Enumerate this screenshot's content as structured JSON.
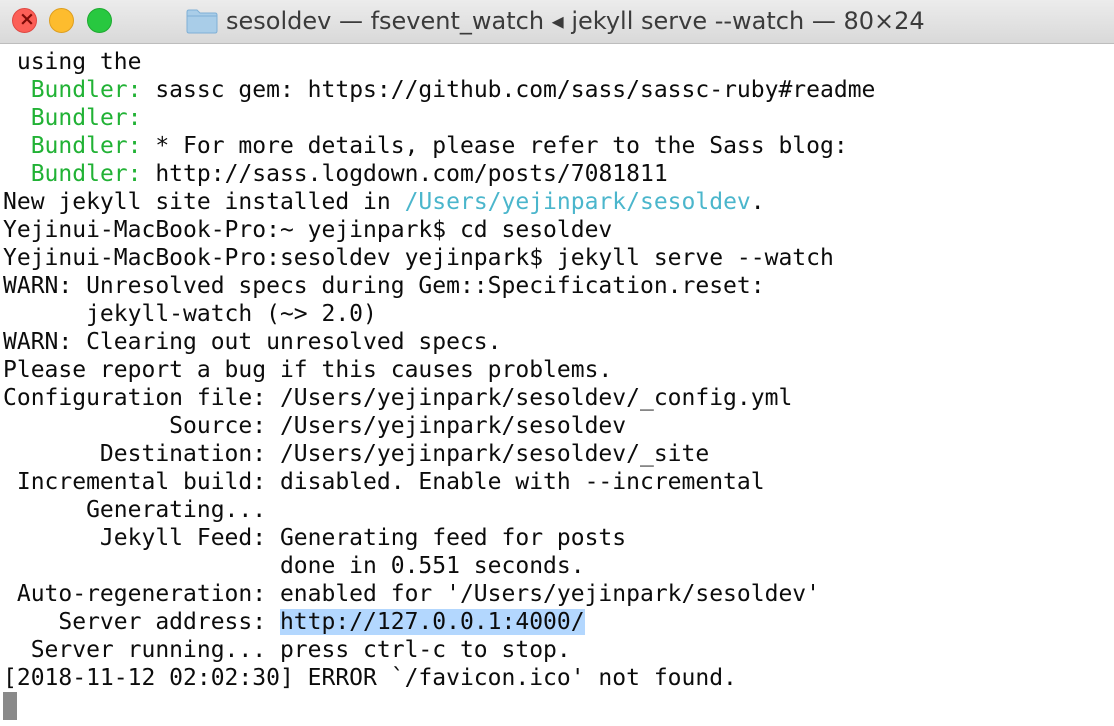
{
  "window": {
    "title": "sesoldev — fsevent_watch ◂ jekyll serve --watch — 80×24"
  },
  "terminal": {
    "lines": [
      {
        "pre": " using the",
        "hl": "",
        "post": ""
      },
      {
        "pre": "  ",
        "hl": "Bundler:",
        "post": " sassc gem: https://github.com/sass/sassc-ruby#readme"
      },
      {
        "pre": "  ",
        "hl": "Bundler:",
        "post": ""
      },
      {
        "pre": "  ",
        "hl": "Bundler:",
        "post": " * For more details, please refer to the Sass blog:"
      },
      {
        "pre": "  ",
        "hl": "Bundler:",
        "post": " http://sass.logdown.com/posts/7081811"
      },
      {
        "pre": "New jekyll site installed in ",
        "hl": "/Users/yejinpark/sesoldev",
        "post": "."
      },
      {
        "pre": "Yejinui-MacBook-Pro:~ yejinpark$ cd sesoldev",
        "hl": "",
        "post": ""
      },
      {
        "pre": "Yejinui-MacBook-Pro:sesoldev yejinpark$ jekyll serve --watch",
        "hl": "",
        "post": ""
      },
      {
        "pre": "WARN: Unresolved specs during Gem::Specification.reset:",
        "hl": "",
        "post": ""
      },
      {
        "pre": "      jekyll-watch (~> 2.0)",
        "hl": "",
        "post": ""
      },
      {
        "pre": "WARN: Clearing out unresolved specs.",
        "hl": "",
        "post": ""
      },
      {
        "pre": "Please report a bug if this causes problems.",
        "hl": "",
        "post": ""
      },
      {
        "pre": "Configuration file: /Users/yejinpark/sesoldev/_config.yml",
        "hl": "",
        "post": ""
      },
      {
        "pre": "            Source: /Users/yejinpark/sesoldev",
        "hl": "",
        "post": ""
      },
      {
        "pre": "       Destination: /Users/yejinpark/sesoldev/_site",
        "hl": "",
        "post": ""
      },
      {
        "pre": " Incremental build: disabled. Enable with --incremental",
        "hl": "",
        "post": ""
      },
      {
        "pre": "      Generating...",
        "hl": "",
        "post": ""
      },
      {
        "pre": "       Jekyll Feed: Generating feed for posts",
        "hl": "",
        "post": ""
      },
      {
        "pre": "                    done in 0.551 seconds.",
        "hl": "",
        "post": ""
      },
      {
        "pre": " Auto-regeneration: enabled for '/Users/yejinpark/sesoldev'",
        "hl": "",
        "post": ""
      },
      {
        "pre": "    Server address: ",
        "hl": "http://127.0.0.1:4000/",
        "post": ""
      },
      {
        "pre": "  Server running... press ctrl-c to stop.",
        "hl": "",
        "post": ""
      },
      {
        "pre": "[2018-11-12 02:02:30] ERROR `/favicon.ico' not found.",
        "hl": "",
        "post": ""
      }
    ]
  },
  "colors": {
    "bundler_green": "#21b235",
    "path_cyan": "#4bb6cc",
    "selection": "#b3d7fe"
  },
  "icons": {
    "close": "close-icon",
    "minimize": "minimize-icon",
    "zoom": "zoom-icon",
    "folder": "folder-icon"
  }
}
